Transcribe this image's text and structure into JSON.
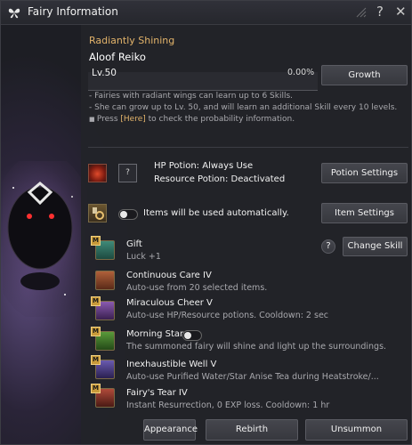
{
  "window": {
    "title": "Fairy Information",
    "help_glyph": "?",
    "close_glyph": "✕"
  },
  "fairy": {
    "tier": "Radiantly Shining",
    "name": "Aloof Reiko",
    "level": "Lv.50",
    "growth_percent": "0.00%",
    "growth_progress": 0.0,
    "growth_button": "Growth"
  },
  "notes": [
    "- Fairies with radiant wings can learn up to 6 Skills.",
    "- She can grow up to Lv. 50, and will learn an additional Skill every 10 levels."
  ],
  "probability": {
    "prefix": "Press ",
    "link": "[Here]",
    "suffix": " to check the probability information."
  },
  "potion": {
    "slot_glyph": "?",
    "hp": "HP Potion: Always Use",
    "resource": "Resource Potion: Deactivated",
    "button": "Potion Settings"
  },
  "items": {
    "label": "Items will be used automatically.",
    "button": "Item Settings"
  },
  "skills_header": {
    "help_glyph": "?",
    "change_button": "Change Skill"
  },
  "skills": [
    {
      "name": "Gift",
      "desc": "Luck +1",
      "badge": "M",
      "color": "#2d6b5e"
    },
    {
      "name": "Continuous Care IV",
      "desc": "Auto-use from 20 selected items.",
      "badge": "",
      "color": "#7a3a2a"
    },
    {
      "name": "Miraculous Cheer V",
      "desc": "Auto-use HP/Resource potions. Cooldown: 2 sec",
      "badge": "M",
      "color": "#5a3a7a"
    },
    {
      "name": "Morning Star",
      "desc": "The summoned fairy will shine and light up the surroundings.",
      "badge": "M",
      "color": "#3a6a2a"
    },
    {
      "name": "Inexhaustible Well V",
      "desc": "Auto-use Purified Water/Star Anise Tea during Heatstroke/...",
      "badge": "M",
      "color": "#4a3a7a"
    },
    {
      "name": "Fairy's Tear IV",
      "desc": "Instant Resurrection, 0 EXP loss. Cooldown: 1 hr",
      "badge": "M",
      "color": "#7a2a2a"
    }
  ],
  "footer": {
    "appearance": "Appearance",
    "rebirth": "Rebirth",
    "unsummon": "Unsummon"
  }
}
